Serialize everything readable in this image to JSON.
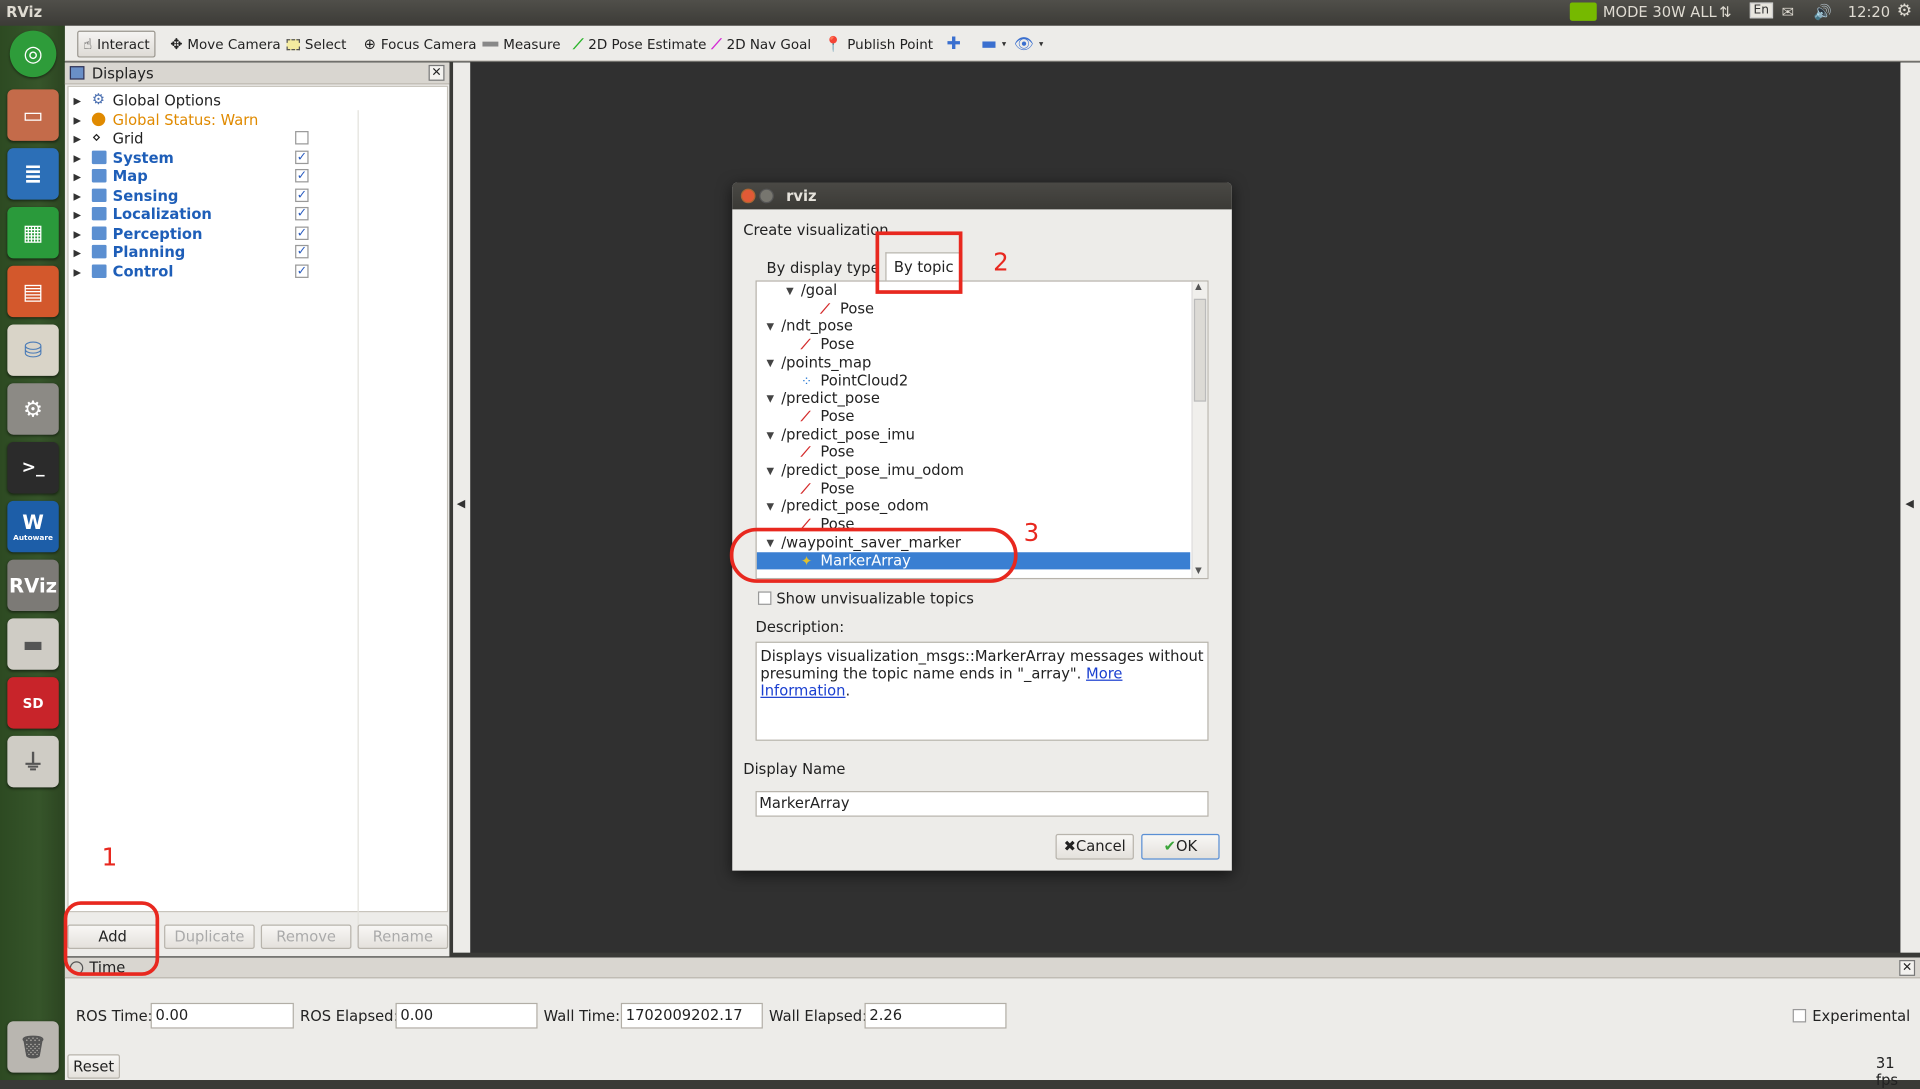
{
  "app_title": "RViz",
  "topbar": {
    "mode": "MODE 30W ALL",
    "lang": "En",
    "clock": "12:20"
  },
  "launcher": {
    "icons": [
      "ubuntu-icon",
      "files-icon",
      "writer-icon",
      "calc-icon",
      "impress-icon",
      "software-center-icon",
      "settings-icon",
      "terminal-icon",
      "autoware-icon",
      "rviz-icon",
      "disk-icon",
      "sd-card-icon",
      "usb-drive-icon",
      "trash-icon"
    ],
    "autoware_label": "Autoware",
    "rviz_label": "RViz"
  },
  "toolbar": {
    "tools": [
      {
        "label": "Interact",
        "icon": "hand-icon"
      },
      {
        "label": "Move Camera",
        "icon": "move-icon"
      },
      {
        "label": "Select",
        "icon": "select-icon"
      },
      {
        "label": "Focus Camera",
        "icon": "focus-icon"
      },
      {
        "label": "Measure",
        "icon": "ruler-icon"
      },
      {
        "label": "2D Pose Estimate",
        "icon": "green-arrow-icon"
      },
      {
        "label": "2D Nav Goal",
        "icon": "magenta-arrow-icon"
      },
      {
        "label": "Publish Point",
        "icon": "pin-icon"
      }
    ]
  },
  "displays": {
    "title": "Displays",
    "items": [
      {
        "label": "Global Options",
        "checked": null
      },
      {
        "label": "Global Status: Warn",
        "checked": null
      },
      {
        "label": "Grid",
        "checked": false
      },
      {
        "label": "System",
        "checked": true
      },
      {
        "label": "Map",
        "checked": true
      },
      {
        "label": "Sensing",
        "checked": true
      },
      {
        "label": "Localization",
        "checked": true
      },
      {
        "label": "Perception",
        "checked": true
      },
      {
        "label": "Planning",
        "checked": true
      },
      {
        "label": "Control",
        "checked": true
      }
    ],
    "buttons": {
      "add": "Add",
      "duplicate": "Duplicate",
      "remove": "Remove",
      "rename": "Rename"
    }
  },
  "time": {
    "title": "Time",
    "ros_time_label": "ROS Time:",
    "ros_time": "0.00",
    "ros_elapsed_label": "ROS Elapsed:",
    "ros_elapsed": "0.00",
    "wall_time_label": "Wall Time:",
    "wall_time": "1702009202.17",
    "wall_elapsed_label": "Wall Elapsed:",
    "wall_elapsed": "2.26",
    "experimental": "Experimental",
    "reset": "Reset",
    "fps": "31 fps"
  },
  "dialog": {
    "title": "rviz",
    "heading": "Create visualization",
    "tabs": [
      "By display type",
      "By topic"
    ],
    "topics": [
      {
        "topic": "/goal",
        "type": "Pose"
      },
      {
        "topic": "/ndt_pose",
        "type": "Pose"
      },
      {
        "topic": "/points_map",
        "type": "PointCloud2"
      },
      {
        "topic": "/predict_pose",
        "type": "Pose"
      },
      {
        "topic": "/predict_pose_imu",
        "type": "Pose"
      },
      {
        "topic": "/predict_pose_imu_odom",
        "type": "Pose"
      },
      {
        "topic": "/predict_pose_odom",
        "type": "Pose"
      },
      {
        "topic": "/waypoint_saver_marker",
        "type": "MarkerArray"
      }
    ],
    "show_unvisualizable": "Show unvisualizable topics",
    "description_label": "Description:",
    "description_text": "Displays visualization_msgs::MarkerArray messages without presuming the topic name ends in \"_array\". ",
    "description_link": "More Information",
    "description_end": ".",
    "display_name_label": "Display Name",
    "display_name_value": "MarkerArray",
    "cancel": "Cancel",
    "ok": "OK"
  },
  "annotations": {
    "one": "1",
    "two": "2",
    "three": "3"
  },
  "colors": {
    "annotation": "#e8281f",
    "selection": "#3a7fd2",
    "accent_blue": "#1e5eb8",
    "warn": "#e08a00"
  }
}
